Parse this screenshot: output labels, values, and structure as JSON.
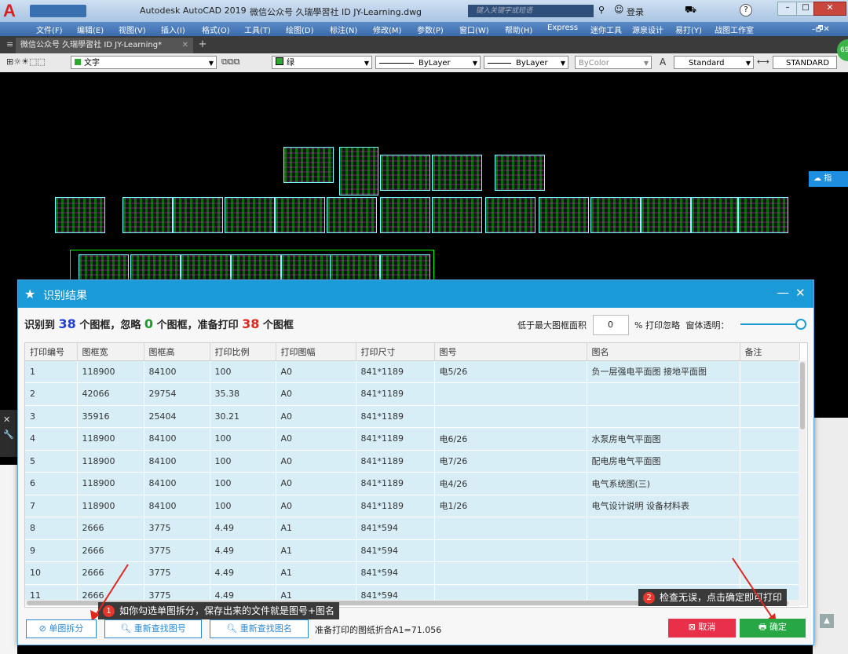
{
  "window": {
    "title": "Autodesk AutoCAD 2019",
    "subtitle": "微信公众号  久瑞學習社 ID  JY-Learning.dwg",
    "search_placeholder": "键入关键字或短语",
    "login": "登录"
  },
  "menu": [
    "文件(F)",
    "编辑(E)",
    "视图(V)",
    "插入(I)",
    "格式(O)",
    "工具(T)",
    "绘图(D)",
    "标注(N)",
    "修改(M)",
    "参数(P)",
    "窗口(W)",
    "帮助(H)",
    "Express",
    "迷你工具",
    "源泉设计",
    "易打(Y)",
    "战图工作室"
  ],
  "doc_tab": "微信公众号  久瑞學習社 ID  JY-Learning*",
  "toolbar": {
    "layer": "文字",
    "color": "绿",
    "linetype": "ByLayer",
    "lineweight": "ByLayer",
    "plotstyle": "ByColor",
    "textstyle": "Standard",
    "dimstyle": "STANDARD",
    "badge": "69"
  },
  "side_tab": "指",
  "dialog": {
    "title": "识别结果",
    "summary_prefix": "识别到",
    "found": "38",
    "summary_mid1": "个图框，忽略",
    "ignored": "0",
    "summary_mid2": "个图框，准备打印",
    "to_print": "38",
    "summary_suffix": "个图框",
    "area_label": "低于最大图框面积",
    "area_value": "0",
    "area_suffix": "% 打印忽略",
    "transparency_label": "窗体透明：",
    "columns": [
      "打印编号",
      "图框宽",
      "图框高",
      "打印比例",
      "打印图幅",
      "打印尺寸",
      "图号",
      "图名",
      "备注"
    ],
    "rows": [
      [
        "1",
        "118900",
        "84100",
        "100",
        "A0",
        "841*1189",
        "电5/26",
        "负一层强电平面图 接地平面图",
        ""
      ],
      [
        "2",
        "42066",
        "29754",
        "35.38",
        "A0",
        "841*1189",
        "",
        "",
        ""
      ],
      [
        "3",
        "35916",
        "25404",
        "30.21",
        "A0",
        "841*1189",
        "",
        "",
        ""
      ],
      [
        "4",
        "118900",
        "84100",
        "100",
        "A0",
        "841*1189",
        "电6/26",
        "水泵房电气平面图",
        ""
      ],
      [
        "5",
        "118900",
        "84100",
        "100",
        "A0",
        "841*1189",
        "电7/26",
        "配电房电气平面图",
        ""
      ],
      [
        "6",
        "118900",
        "84100",
        "100",
        "A0",
        "841*1189",
        "电4/26",
        "电气系统图(三)",
        ""
      ],
      [
        "7",
        "118900",
        "84100",
        "100",
        "A0",
        "841*1189",
        "电1/26",
        "电气设计说明 设备材料表",
        ""
      ],
      [
        "8",
        "2666",
        "3775",
        "4.49",
        "A1",
        "841*594",
        "",
        "",
        ""
      ],
      [
        "9",
        "2666",
        "3775",
        "4.49",
        "A1",
        "841*594",
        "",
        "",
        ""
      ],
      [
        "10",
        "2666",
        "3775",
        "4.49",
        "A1",
        "841*594",
        "",
        "",
        ""
      ],
      [
        "11",
        "2666",
        "3775",
        "4.49",
        "A1",
        "841*594",
        "",
        "",
        ""
      ]
    ],
    "btn_split": "单图拆分",
    "btn_find_no": "重新查找图号",
    "btn_find_name": "重新查找图名",
    "status": "准备打印的图纸折合A1=71.056",
    "btn_cancel": "取消",
    "btn_ok": "确定",
    "tip1_num": "1",
    "tip1": "如你勾选单图拆分，保存出来的文件就是图号+图名",
    "tip2_num": "2",
    "tip2": "检查无误，点击确定即可打印"
  },
  "colors": {
    "accent": "#1a9ad6",
    "found": "#1f3fd8",
    "ignored": "#1a9a2a",
    "to_print": "#e0271e",
    "cancel": "#e8304a",
    "ok": "#27a844"
  }
}
